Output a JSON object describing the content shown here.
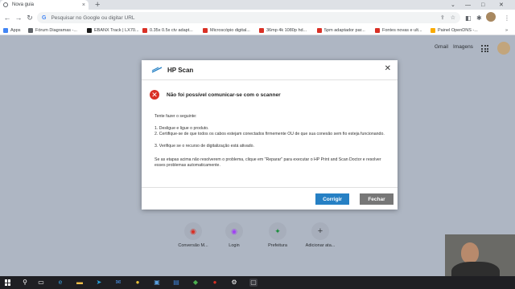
{
  "browser": {
    "tab": {
      "title": "Nova guia",
      "close": "×"
    },
    "new_tab": "+",
    "window_controls": {
      "chevron": "⌄",
      "minimize": "—",
      "maximize": "□",
      "close": "✕"
    },
    "nav": {
      "back": "←",
      "forward": "→",
      "reload": "↻"
    },
    "omnibox": {
      "placeholder": "Pesquisar no Google ou digitar URL"
    },
    "toolbar_icons": [
      "share-icon",
      "star-icon",
      "extension-icon",
      "puzzle-icon",
      "menu-icon"
    ],
    "bookmarks": [
      {
        "label": "Apps",
        "color": "#4285f4"
      },
      {
        "label": "Fórum Diagramas -...",
        "color": "#5f6368"
      },
      {
        "label": "EBANX Track | LX70...",
        "color": "#1a1a1a"
      },
      {
        "label": "0.35x 0.5x ctv adapt...",
        "color": "#d93025"
      },
      {
        "label": "Microscópio digital...",
        "color": "#d93025"
      },
      {
        "label": "36mp 4k 1080p hd...",
        "color": "#d93025"
      },
      {
        "label": "5pm adaptador par...",
        "color": "#d93025"
      },
      {
        "label": "Fontes novas e ult...",
        "color": "#d93025"
      },
      {
        "label": "Painel OpenDNS -...",
        "color": "#f9ab00"
      }
    ],
    "more_bookmarks": "»"
  },
  "newtab_page": {
    "links": [
      "Gmail",
      "Imagens"
    ],
    "shortcuts": [
      {
        "label": "Conversão M...",
        "color": "#d93025",
        "glyph": "◉"
      },
      {
        "label": "Login",
        "color": "#a142f4",
        "glyph": "◉"
      },
      {
        "label": "Prefeitura",
        "color": "#1e8e3e",
        "glyph": "✦"
      },
      {
        "label": "Adicionar ata...",
        "color": "#3c4043",
        "glyph": "+"
      }
    ]
  },
  "dialog": {
    "title": "HP Scan",
    "close": "✕",
    "error_title": "Não foi possível comunicar-se com o scanner",
    "error_glyph": "✕",
    "intro": "Tente fazer o seguinte:",
    "steps": [
      "1. Desligue e ligue o produto.",
      "2. Certifique-se de que todos os cabos estejam conectados firmemente OU de que sua conexão sem fio esteja funcionando.",
      "3. Verifique se o recurso de digitalização está ativado."
    ],
    "outro": "Se as etapas acima não resolverem o problema, clique em \"Reparar\" para executar o HP Print and Scan Doctor e resolver esses problemas automaticamente.",
    "repair_button": "Corrigir",
    "close_button": "Fechar",
    "accent": "#2680c4"
  },
  "taskbar": {
    "icons": [
      {
        "name": "search-icon",
        "glyph": "⚲",
        "color": "#ffffff"
      },
      {
        "name": "task-view-icon",
        "glyph": "▭",
        "color": "#ffffff"
      },
      {
        "name": "edge-icon",
        "glyph": "e",
        "color": "#3aa0e0"
      },
      {
        "name": "explorer-icon",
        "glyph": "▬",
        "color": "#f5c04a"
      },
      {
        "name": "telegram-icon",
        "glyph": "➤",
        "color": "#2aa3df"
      },
      {
        "name": "mail-icon",
        "glyph": "✉",
        "color": "#4a8fe0"
      },
      {
        "name": "chrome-icon",
        "glyph": "●",
        "color": "#e8c13a"
      },
      {
        "name": "photos-icon",
        "glyph": "▣",
        "color": "#5aa0e0"
      },
      {
        "name": "store-icon",
        "glyph": "▤",
        "color": "#3b7fd4"
      },
      {
        "name": "app-icon",
        "glyph": "◆",
        "color": "#4caf50"
      },
      {
        "name": "recorder-icon",
        "glyph": "●",
        "color": "#d93025"
      },
      {
        "name": "settings-icon",
        "glyph": "⚙",
        "color": "#ffffff"
      },
      {
        "name": "hp-scan-icon",
        "glyph": "▢",
        "color": "#cfcfcf"
      }
    ]
  }
}
